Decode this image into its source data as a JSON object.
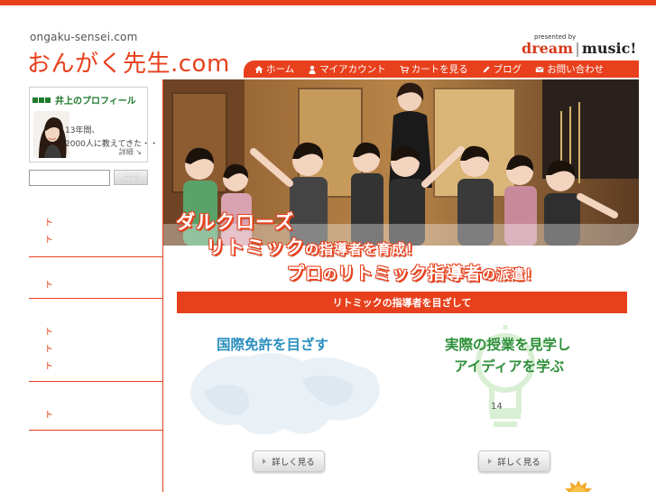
{
  "header": {
    "site_url": "ongaku-sensei.com",
    "site_title": "おんがく先生.com",
    "presented_by": "presented by",
    "brand_dream": "dream",
    "brand_music": "music",
    "brand_bang": "!"
  },
  "nav": {
    "items": [
      {
        "label": "ホーム",
        "icon": "home-icon"
      },
      {
        "label": "マイアカウント",
        "icon": "person-icon"
      },
      {
        "label": "カートを見る",
        "icon": "cart-icon"
      },
      {
        "label": "ブログ",
        "icon": "pencil-icon"
      },
      {
        "label": "お問い合わせ",
        "icon": "mail-icon"
      }
    ]
  },
  "sidebar": {
    "profile": {
      "heading": "井上のプロフィール",
      "text1": "13年間、",
      "text2": "2000人に教えてきた・・",
      "more": "詳細"
    },
    "search": {
      "button": "検索",
      "value": ""
    },
    "links": [
      "ト",
      "ト",
      "ト",
      "ト",
      "ト",
      "ト",
      "ト"
    ]
  },
  "hero": {
    "line1": "ダルクローズ",
    "line2_a": "リトミック",
    "line2_b": "の指導者を育成！",
    "line3_a": "プロ",
    "line3_b": "の",
    "line3_c": "リトミック指導者",
    "line3_d": "の派遣！"
  },
  "section": {
    "title": "リトミックの指導者を目ざして"
  },
  "features": [
    {
      "title": "国際免許を目ざす",
      "button": "詳しく見る"
    },
    {
      "title_line1": "実際の授業を見学し",
      "title_line2": "アイディアを学ぶ",
      "number": "14",
      "button": "詳しく見る"
    }
  ],
  "colors": {
    "accent": "#e8401c",
    "blue_title": "#2a8fbf",
    "green_title": "#2e8f3a"
  }
}
